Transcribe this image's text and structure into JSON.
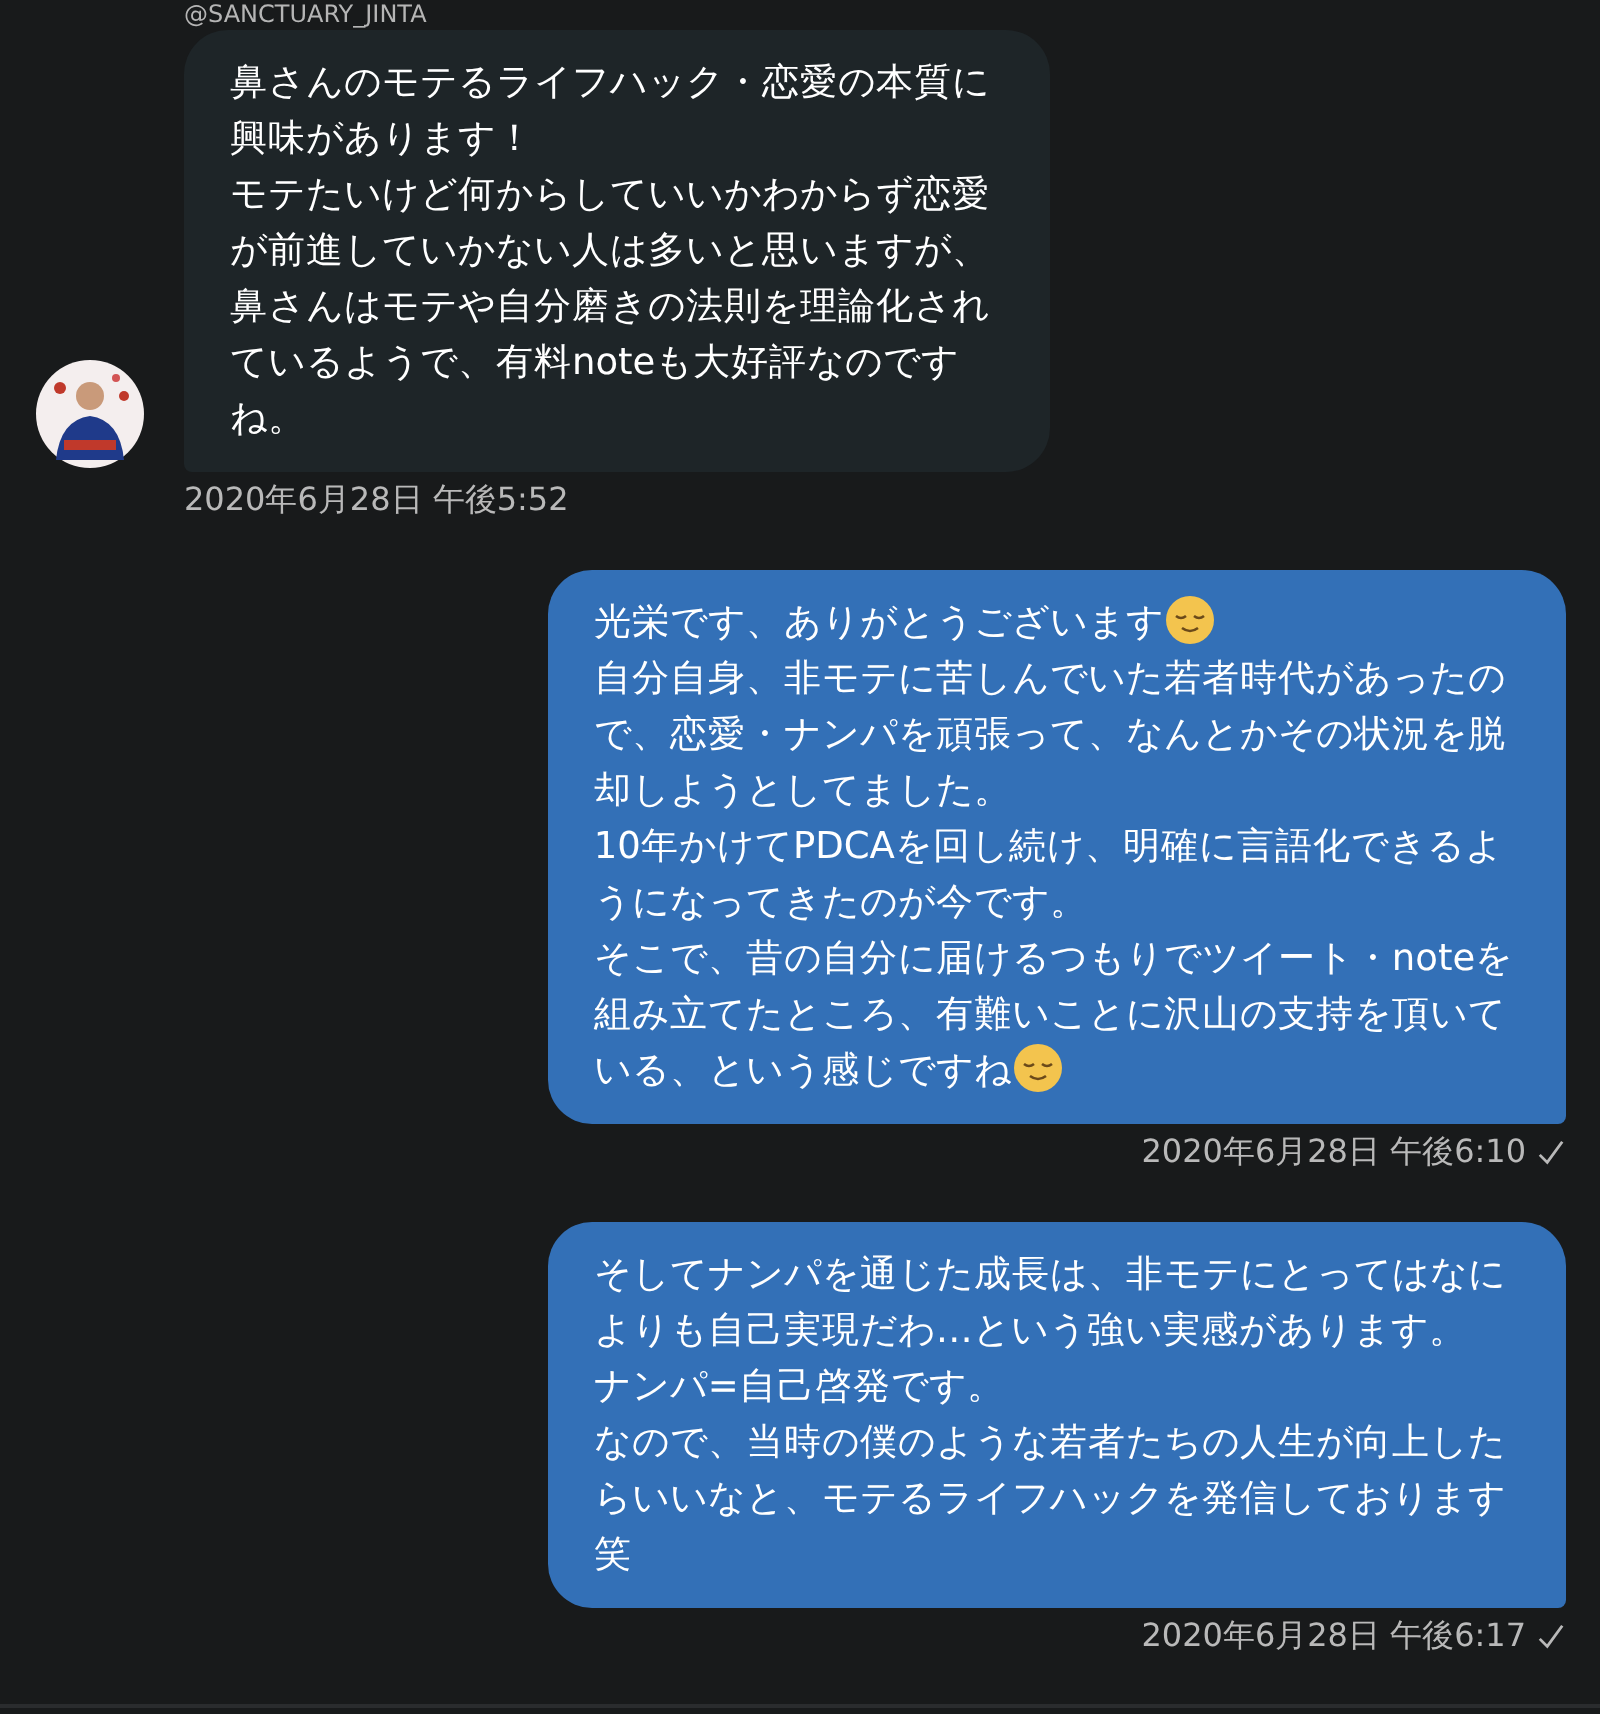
{
  "conversation": {
    "handle": "@SANCTUARY_JINTA",
    "messages": [
      {
        "kind": "received",
        "segments": [
          {
            "kind": "text",
            "text": "鼻さんのモテるライフハック・恋愛の本質に興味があります！"
          },
          {
            "kind": "text",
            "text": "モテたいけど何からしていいかわからず恋愛が前進していかない人は多いと思いますが、鼻さんはモテや自分磨きの法則を理論化されているようで、有料noteも大好評なのですね。"
          }
        ],
        "time": "2020年6月28日 午後5:52"
      },
      {
        "kind": "sent",
        "segments": [
          {
            "kind": "text",
            "text": "光栄です、ありがとうございます"
          },
          {
            "kind": "emoji"
          },
          {
            "kind": "text",
            "text": "自分自身、非モテに苦しんでいた若者時代があったので、恋愛・ナンパを頑張って、なんとかその状況を脱却しようとしてました。"
          },
          {
            "kind": "text",
            "text": "10年かけてPDCAを回し続け、明確に言語化できるようになってきたのが今です。"
          },
          {
            "kind": "text",
            "text": "そこで、昔の自分に届けるつもりでツイート・noteを組み立てたところ、有難いことに沢山の支持を頂いて"
          },
          {
            "kind": "text",
            "text": "いる、という感じですね"
          },
          {
            "kind": "emoji"
          }
        ],
        "time": "2020年6月28日 午後6:10",
        "read": true
      },
      {
        "kind": "sent",
        "segments": [
          {
            "kind": "text",
            "text": "そしてナンパを通じた成長は、非モテにとってはなによりも自己実現だわ…という強い実感があります。"
          },
          {
            "kind": "text",
            "text": "ナンパ=自己啓発です。"
          },
          {
            "kind": "text",
            "text": "なので、当時の僕のような若者たちの人生が向上したらいいなと、モテるライフハックを発信しております笑"
          }
        ],
        "time": "2020年6月28日 午後6:17",
        "read": true
      }
    ]
  }
}
